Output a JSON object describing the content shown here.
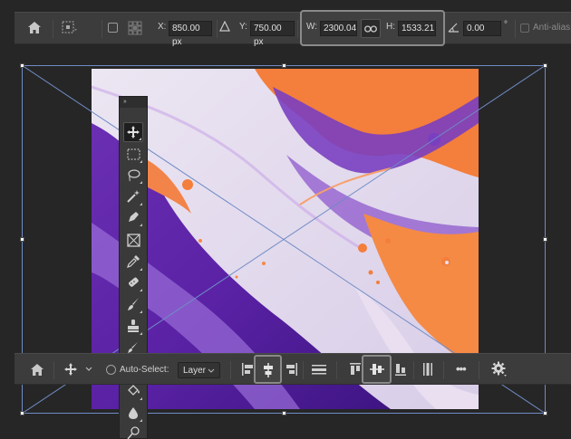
{
  "transform_bar": {
    "x_label": "X:",
    "x_value": "850.00 px",
    "y_label": "Y:",
    "y_value": "750.00 px",
    "w_label": "W:",
    "w_value": "2300.04",
    "h_label": "H:",
    "h_value": "1533.21",
    "angle_value": "0.00",
    "angle_unit": "°",
    "anti_alias_label": "Anti-alias"
  },
  "tools_panel": {
    "grip_label": "››",
    "tools": [
      {
        "icon": "move-icon",
        "active": true
      },
      {
        "icon": "marquee-icon",
        "active": false
      },
      {
        "icon": "lasso-icon",
        "active": false
      },
      {
        "icon": "magic-wand-icon",
        "active": false
      },
      {
        "icon": "crop-icon",
        "active": false
      },
      {
        "icon": "frame-icon",
        "active": false
      },
      {
        "icon": "eyedropper-icon",
        "active": false
      },
      {
        "icon": "healing-brush-icon",
        "active": false
      },
      {
        "icon": "brush-icon",
        "active": false
      },
      {
        "icon": "clone-stamp-icon",
        "active": false
      },
      {
        "icon": "history-brush-icon",
        "active": false
      },
      {
        "icon": "eraser-icon",
        "active": false
      },
      {
        "icon": "paint-bucket-icon",
        "active": false
      },
      {
        "icon": "blur-icon",
        "active": false
      },
      {
        "icon": "dodge-icon",
        "active": false
      }
    ]
  },
  "context_bar": {
    "auto_select_label": "Auto-Select:",
    "auto_select_value": "Layer",
    "more_label": "•••"
  },
  "colors": {
    "bar_bg": "#3c3c3c",
    "workspace_bg": "#262626",
    "selection_line": "#6f8bc4",
    "highlight_border": "#8a8a8a"
  }
}
